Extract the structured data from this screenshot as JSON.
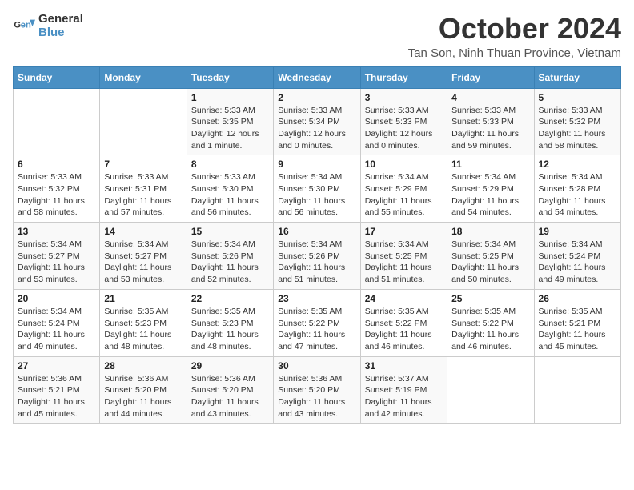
{
  "logo": {
    "line1": "General",
    "line2": "Blue"
  },
  "title": "October 2024",
  "location": "Tan Son, Ninh Thuan Province, Vietnam",
  "days_header": [
    "Sunday",
    "Monday",
    "Tuesday",
    "Wednesday",
    "Thursday",
    "Friday",
    "Saturday"
  ],
  "weeks": [
    [
      {
        "day": "",
        "info": ""
      },
      {
        "day": "",
        "info": ""
      },
      {
        "day": "1",
        "info": "Sunrise: 5:33 AM\nSunset: 5:35 PM\nDaylight: 12 hours\nand 1 minute."
      },
      {
        "day": "2",
        "info": "Sunrise: 5:33 AM\nSunset: 5:34 PM\nDaylight: 12 hours\nand 0 minutes."
      },
      {
        "day": "3",
        "info": "Sunrise: 5:33 AM\nSunset: 5:33 PM\nDaylight: 12 hours\nand 0 minutes."
      },
      {
        "day": "4",
        "info": "Sunrise: 5:33 AM\nSunset: 5:33 PM\nDaylight: 11 hours\nand 59 minutes."
      },
      {
        "day": "5",
        "info": "Sunrise: 5:33 AM\nSunset: 5:32 PM\nDaylight: 11 hours\nand 58 minutes."
      }
    ],
    [
      {
        "day": "6",
        "info": "Sunrise: 5:33 AM\nSunset: 5:32 PM\nDaylight: 11 hours\nand 58 minutes."
      },
      {
        "day": "7",
        "info": "Sunrise: 5:33 AM\nSunset: 5:31 PM\nDaylight: 11 hours\nand 57 minutes."
      },
      {
        "day": "8",
        "info": "Sunrise: 5:33 AM\nSunset: 5:30 PM\nDaylight: 11 hours\nand 56 minutes."
      },
      {
        "day": "9",
        "info": "Sunrise: 5:34 AM\nSunset: 5:30 PM\nDaylight: 11 hours\nand 56 minutes."
      },
      {
        "day": "10",
        "info": "Sunrise: 5:34 AM\nSunset: 5:29 PM\nDaylight: 11 hours\nand 55 minutes."
      },
      {
        "day": "11",
        "info": "Sunrise: 5:34 AM\nSunset: 5:29 PM\nDaylight: 11 hours\nand 54 minutes."
      },
      {
        "day": "12",
        "info": "Sunrise: 5:34 AM\nSunset: 5:28 PM\nDaylight: 11 hours\nand 54 minutes."
      }
    ],
    [
      {
        "day": "13",
        "info": "Sunrise: 5:34 AM\nSunset: 5:27 PM\nDaylight: 11 hours\nand 53 minutes."
      },
      {
        "day": "14",
        "info": "Sunrise: 5:34 AM\nSunset: 5:27 PM\nDaylight: 11 hours\nand 53 minutes."
      },
      {
        "day": "15",
        "info": "Sunrise: 5:34 AM\nSunset: 5:26 PM\nDaylight: 11 hours\nand 52 minutes."
      },
      {
        "day": "16",
        "info": "Sunrise: 5:34 AM\nSunset: 5:26 PM\nDaylight: 11 hours\nand 51 minutes."
      },
      {
        "day": "17",
        "info": "Sunrise: 5:34 AM\nSunset: 5:25 PM\nDaylight: 11 hours\nand 51 minutes."
      },
      {
        "day": "18",
        "info": "Sunrise: 5:34 AM\nSunset: 5:25 PM\nDaylight: 11 hours\nand 50 minutes."
      },
      {
        "day": "19",
        "info": "Sunrise: 5:34 AM\nSunset: 5:24 PM\nDaylight: 11 hours\nand 49 minutes."
      }
    ],
    [
      {
        "day": "20",
        "info": "Sunrise: 5:34 AM\nSunset: 5:24 PM\nDaylight: 11 hours\nand 49 minutes."
      },
      {
        "day": "21",
        "info": "Sunrise: 5:35 AM\nSunset: 5:23 PM\nDaylight: 11 hours\nand 48 minutes."
      },
      {
        "day": "22",
        "info": "Sunrise: 5:35 AM\nSunset: 5:23 PM\nDaylight: 11 hours\nand 48 minutes."
      },
      {
        "day": "23",
        "info": "Sunrise: 5:35 AM\nSunset: 5:22 PM\nDaylight: 11 hours\nand 47 minutes."
      },
      {
        "day": "24",
        "info": "Sunrise: 5:35 AM\nSunset: 5:22 PM\nDaylight: 11 hours\nand 46 minutes."
      },
      {
        "day": "25",
        "info": "Sunrise: 5:35 AM\nSunset: 5:22 PM\nDaylight: 11 hours\nand 46 minutes."
      },
      {
        "day": "26",
        "info": "Sunrise: 5:35 AM\nSunset: 5:21 PM\nDaylight: 11 hours\nand 45 minutes."
      }
    ],
    [
      {
        "day": "27",
        "info": "Sunrise: 5:36 AM\nSunset: 5:21 PM\nDaylight: 11 hours\nand 45 minutes."
      },
      {
        "day": "28",
        "info": "Sunrise: 5:36 AM\nSunset: 5:20 PM\nDaylight: 11 hours\nand 44 minutes."
      },
      {
        "day": "29",
        "info": "Sunrise: 5:36 AM\nSunset: 5:20 PM\nDaylight: 11 hours\nand 43 minutes."
      },
      {
        "day": "30",
        "info": "Sunrise: 5:36 AM\nSunset: 5:20 PM\nDaylight: 11 hours\nand 43 minutes."
      },
      {
        "day": "31",
        "info": "Sunrise: 5:37 AM\nSunset: 5:19 PM\nDaylight: 11 hours\nand 42 minutes."
      },
      {
        "day": "",
        "info": ""
      },
      {
        "day": "",
        "info": ""
      }
    ]
  ]
}
